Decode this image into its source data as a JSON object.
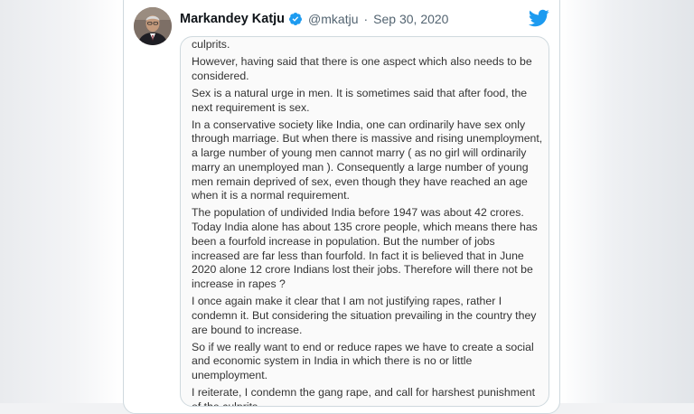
{
  "tweet": {
    "author_name": "Markandey Katju",
    "handle": "@mkatju",
    "separator": "·",
    "date": "Sep 30, 2020",
    "verified": true,
    "icons": {
      "verified": "verified-badge-icon",
      "logo": "twitter-bird-icon"
    },
    "colors": {
      "accent": "#1d9bf0",
      "border": "#cfd9de",
      "secondary_text": "#536471"
    },
    "image_text": {
      "paragraphs": [
        "I condemn the Hathras gang rape, and call for harsh punishment of the culprits.",
        "However, having said that there is one aspect which also needs to be considered.",
        "Sex is a natural urge in men. It is sometimes said that after food, the next requirement is sex.",
        "In a conservative society like India, one can ordinarily have sex only through marriage. But when there is massive and rising unemployment, a large number of young men cannot marry ( as no girl will ordinarily marry an unemployed man ). Consequently a large number of young men remain deprived of sex, even though they have reached an age when it is a normal requirement.",
        "The population of undivided India before 1947 was about 42 crores. Today India alone has about 135 crore people, which means there has been a fourfold increase in population. But the number of jobs increased are far less than fourfold. In fact it is believed that in June 2020 alone 12 crore Indians lost their jobs. Therefore will there not be increase in rapes ?",
        "I once again make it clear that I am not justifying rapes, rather I condemn it. But considering the situation prevailing in the country they are bound to increase.",
        "So if we really want to end or reduce rapes we have to create a social and economic system in India in which there is no or little unemployment.",
        "I reiterate, I condemn the gang rape, and call for harshest punishment of the culprits."
      ]
    }
  }
}
